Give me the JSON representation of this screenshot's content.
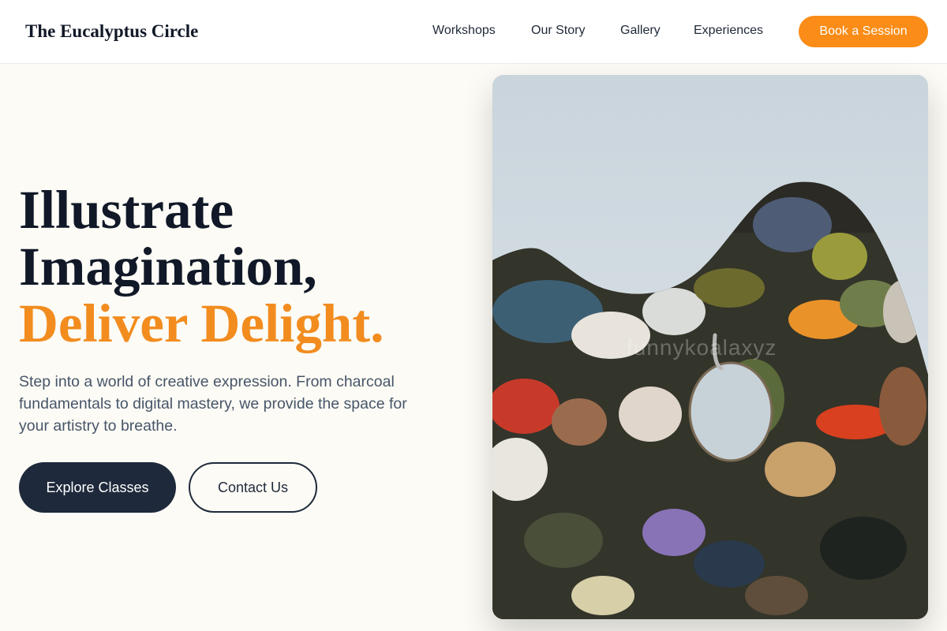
{
  "header": {
    "brand": "The Eucalyptus Circle",
    "nav": [
      "Workshops",
      "Our Story",
      "Gallery",
      "Experiences"
    ],
    "cta_label": "Book a Session"
  },
  "hero": {
    "headline_line1": "Illustrate",
    "headline_line2": "Imagination,",
    "headline_accent": "Deliver Delight.",
    "description": "Step into a world of creative expression. From charcoal fundamentals to digital mastery, we provide the space for your artistry to breathe.",
    "primary_button": "Explore Classes",
    "secondary_button": "Contact Us",
    "image_watermark": "funnykoalaxyz"
  },
  "colors": {
    "accent": "#fa8c17",
    "dark": "#1e293b",
    "background": "#fcfbf5"
  },
  "icons": {
    "hero_image": "paint-palette-photo"
  }
}
